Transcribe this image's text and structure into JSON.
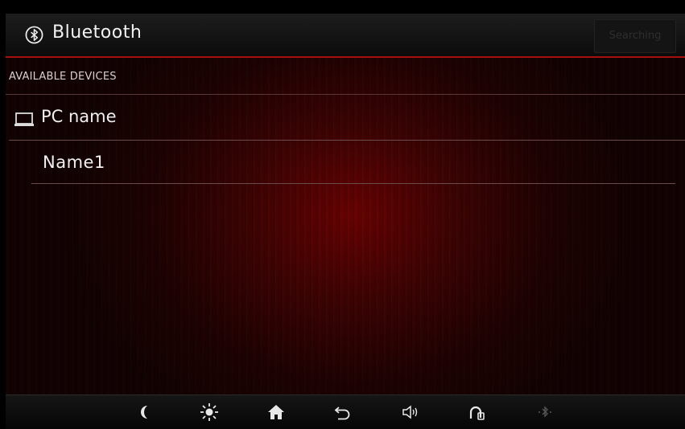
{
  "header": {
    "title": "Bluetooth",
    "search_button_label": "Searching",
    "icon": "bluetooth-icon"
  },
  "section": {
    "label": "AVAILABLE DEVICES"
  },
  "devices": [
    {
      "icon": "laptop-icon",
      "label": "PC name"
    },
    {
      "label": "Name1"
    }
  ],
  "bottom_bar": {
    "icons": [
      "moon-icon",
      "brightness-icon",
      "home-icon",
      "back-icon",
      "volume-icon",
      "phone-mode-icon",
      "bluetooth-signal-icon"
    ]
  },
  "colors": {
    "accent": "#a80f0f",
    "background": "#3a0303",
    "text": "#f0f0f0"
  }
}
